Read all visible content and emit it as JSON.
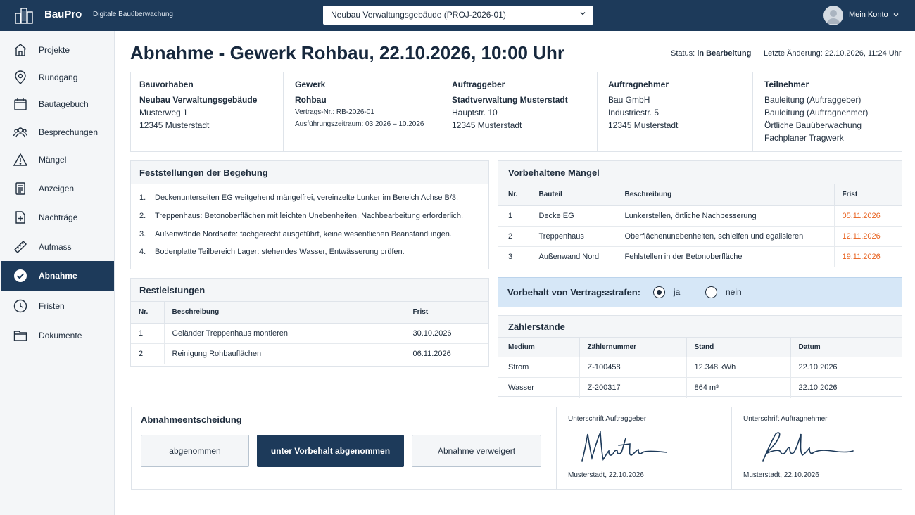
{
  "app": {
    "name": "BauPro",
    "tagline": "Digitale Bauüberwachung",
    "project_selected": "Neubau Verwaltungsgebäude (PROJ-2026-01)",
    "account_label": "Mein Konto"
  },
  "sidebar": {
    "items": [
      {
        "label": "Projekte",
        "icon": "home-icon"
      },
      {
        "label": "Rundgang",
        "icon": "location-pin-icon"
      },
      {
        "label": "Bautagebuch",
        "icon": "calendar-icon"
      },
      {
        "label": "Besprechungen",
        "icon": "people-icon"
      },
      {
        "label": "Mängel",
        "icon": "warning-icon"
      },
      {
        "label": "Anzeigen",
        "icon": "document-icon"
      },
      {
        "label": "Nachträge",
        "icon": "add-document-icon"
      },
      {
        "label": "Aufmass",
        "icon": "ruler-icon"
      },
      {
        "label": "Abnahme",
        "icon": "check-circle-icon",
        "active": true
      },
      {
        "label": "Fristen",
        "icon": "clock-icon"
      },
      {
        "label": "Dokumente",
        "icon": "folder-icon"
      }
    ]
  },
  "header": {
    "title": "Abnahme - Gewerk Rohbau, 22.10.2026, 10:00 Uhr",
    "status_label": "Status:",
    "status_value": "in Bearbeitung",
    "last_change": "Letzte Änderung: 22.10.2026, 11:24 Uhr"
  },
  "info": {
    "bauvorhaben": {
      "heading": "Bauvorhaben",
      "name": "Neubau Verwaltungsgebäude",
      "street": "Musterweg 1",
      "city": "12345 Musterstadt"
    },
    "gewerk": {
      "heading": "Gewerk",
      "name": "Rohbau",
      "contract": "Vertrags-Nr.: RB-2026-01",
      "period": "Ausführungszeitraum: 03.2026 – 10.2026"
    },
    "auftraggeber": {
      "heading": "Auftraggeber",
      "name": "Stadtverwaltung Musterstadt",
      "street": "Hauptstr. 10",
      "city": "12345 Musterstadt"
    },
    "auftragnehmer": {
      "heading": "Auftragnehmer",
      "name": "Bau GmbH",
      "street": "Industriestr. 5",
      "city": "12345 Musterstadt"
    },
    "teilnehmer": {
      "heading": "Teilnehmer",
      "list": [
        "Bauleitung (Auftraggeber)",
        "Bauleitung (Auftragnehmer)",
        "Örtliche Bauüberwachung",
        "Fachplaner Tragwerk"
      ]
    }
  },
  "findings": {
    "heading": "Feststellungen der Begehung",
    "items": [
      {
        "n": "1.",
        "text": "Deckenunterseiten EG weitgehend mängelfrei, vereinzelte Lunker im Bereich Achse B/3."
      },
      {
        "n": "2.",
        "text": "Treppenhaus: Betonoberflächen mit leichten Unebenheiten, Nachbearbeitung erforderlich."
      },
      {
        "n": "3.",
        "text": "Außenwände Nordseite: fachgerecht ausgeführt, keine wesentlichen Beanstandungen."
      },
      {
        "n": "4.",
        "text": "Bodenplatte Teilbereich Lager: stehendes Wasser, Entwässerung prüfen."
      }
    ]
  },
  "defects": {
    "heading": "Vorbehaltene Mängel",
    "columns": [
      "Nr.",
      "Bauteil",
      "Beschreibung",
      "Frist"
    ],
    "rows": [
      [
        "1",
        "Decke EG",
        "Lunkerstellen, örtliche Nachbesserung",
        "05.11.2026"
      ],
      [
        "2",
        "Treppenhaus",
        "Oberflächenunebenheiten, schleifen und egalisieren",
        "12.11.2026"
      ],
      [
        "3",
        "Außenwand Nord",
        "Fehlstellen in der Betonoberfläche",
        "19.11.2026"
      ]
    ],
    "due_color": "#e8601c"
  },
  "rest": {
    "heading": "Restleistungen",
    "columns": [
      "Nr.",
      "Beschreibung",
      "Frist"
    ],
    "rows": [
      [
        "1",
        "Geländer Treppenhaus montieren",
        "30.10.2026"
      ],
      [
        "2",
        "Reinigung Rohbauflächen",
        "06.11.2026"
      ]
    ]
  },
  "penalty": {
    "label": "Vorbehalt von Vertragsstrafen:",
    "options": [
      "ja",
      "nein"
    ],
    "selected": "ja"
  },
  "meters": {
    "heading": "Zählerstände",
    "columns": [
      "Medium",
      "Zählernummer",
      "Stand",
      "Datum"
    ],
    "rows": [
      [
        "Strom",
        "Z-100458",
        "12.348 kWh",
        "22.10.2026"
      ],
      [
        "Wasser",
        "Z-200317",
        "864 m³",
        "22.10.2026"
      ]
    ]
  },
  "decision": {
    "heading": "Abnahmeentscheidung",
    "buttons": [
      "abgenommen",
      "unter Vorbehalt abgenommen",
      "Abnahme verweigert"
    ],
    "selected": "unter Vorbehalt abgenommen"
  },
  "signatures": [
    {
      "label": "Unterschrift Auftraggeber",
      "place_date": "Musterstadt, 22.10.2026"
    },
    {
      "label": "Unterschrift Auftragnehmer",
      "place_date": "Musterstadt, 22.10.2026"
    }
  ],
  "colors": {
    "primary": "#1d3a5a",
    "accent_due": "#e8601c",
    "info_bg": "#d6e7f7"
  }
}
